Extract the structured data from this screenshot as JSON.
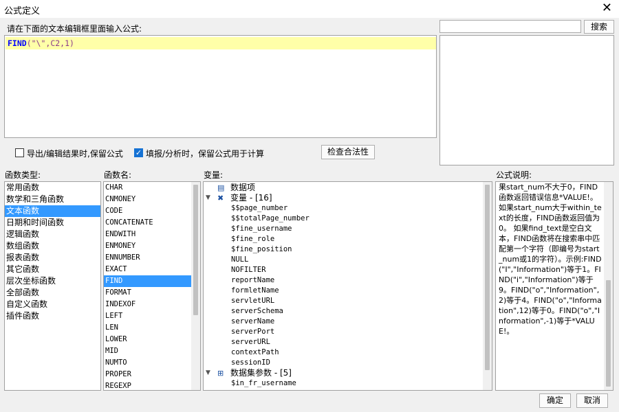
{
  "window": {
    "title": "公式定义",
    "close_glyph": "✕"
  },
  "editor": {
    "prompt_label": "请在下面的文本编辑框里面输入公式:",
    "formula_keyword": "FIND",
    "formula_args": "(\"\\\",C2,1)"
  },
  "search": {
    "placeholder": "",
    "button_label": "搜索"
  },
  "options": {
    "export_keep_label": "导出/编辑结果时,保留公式",
    "export_keep_checked": false,
    "fill_keep_label": "填报/分析时，保留公式用于计算",
    "fill_keep_checked": true,
    "check_button_label": "检查合法性"
  },
  "function_types": {
    "header": "函数类型:",
    "items": [
      "常用函数",
      "数学和三角函数",
      "文本函数",
      "日期和时间函数",
      "逻辑函数",
      "数组函数",
      "报表函数",
      "其它函数",
      "层次坐标函数",
      "全部函数",
      "自定义函数",
      "插件函数"
    ],
    "selected_index": 2
  },
  "function_names": {
    "header": "函数名:",
    "items": [
      "CHAR",
      "CNMONEY",
      "CODE",
      "CONCATENATE",
      "ENDWITH",
      "ENMONEY",
      "ENNUMBER",
      "EXACT",
      "FIND",
      "FORMAT",
      "INDEXOF",
      "LEFT",
      "LEN",
      "LOWER",
      "MID",
      "NUMTO",
      "PROPER",
      "REGEXP"
    ],
    "selected_index": 8
  },
  "variables": {
    "header": "变量:",
    "data_items_label": "数据项",
    "variables_group": "变量 - [16]",
    "variable_items": [
      "$$page_number",
      "$$totalPage_number",
      "$fine_username",
      "$fine_role",
      "$fine_position",
      "NULL",
      "NOFILTER",
      "reportName",
      "formletName",
      "servletURL",
      "serverSchema",
      "serverName",
      "serverPort",
      "serverURL",
      "contextPath",
      "sessionID"
    ],
    "dataset_params_group": "数据集参数 - [5]",
    "dataset_param_items": [
      "$in_fr_username"
    ]
  },
  "description": {
    "header": "公式说明:",
    "text": "果start_num不大于0，FIND函数返回错误信息*VALUE!。    如果start_num大于within_text的长度，FIND函数返回值为0。    如果find_text是空白文本，FIND函数将在搜索串中匹配第一个字符（即编号为start_num或1的字符）。示例:FIND(\"I\",\"Information\")等于1。FIND(\"i\",\"Information\")等于9。FIND(\"o\",\"Information\",2)等于4。FIND(\"o\",\"Information\",12)等于0。FIND(\"o\",\"Information\",-1)等于*VALUE!。"
  },
  "footer": {
    "ok_label": "确定",
    "cancel_label": "取消"
  },
  "colors": {
    "selection": "#3399ff",
    "formula_line_bg": "#ffffa8",
    "formula_keyword": "#0000ff",
    "formula_args": "#8b3a8b"
  }
}
